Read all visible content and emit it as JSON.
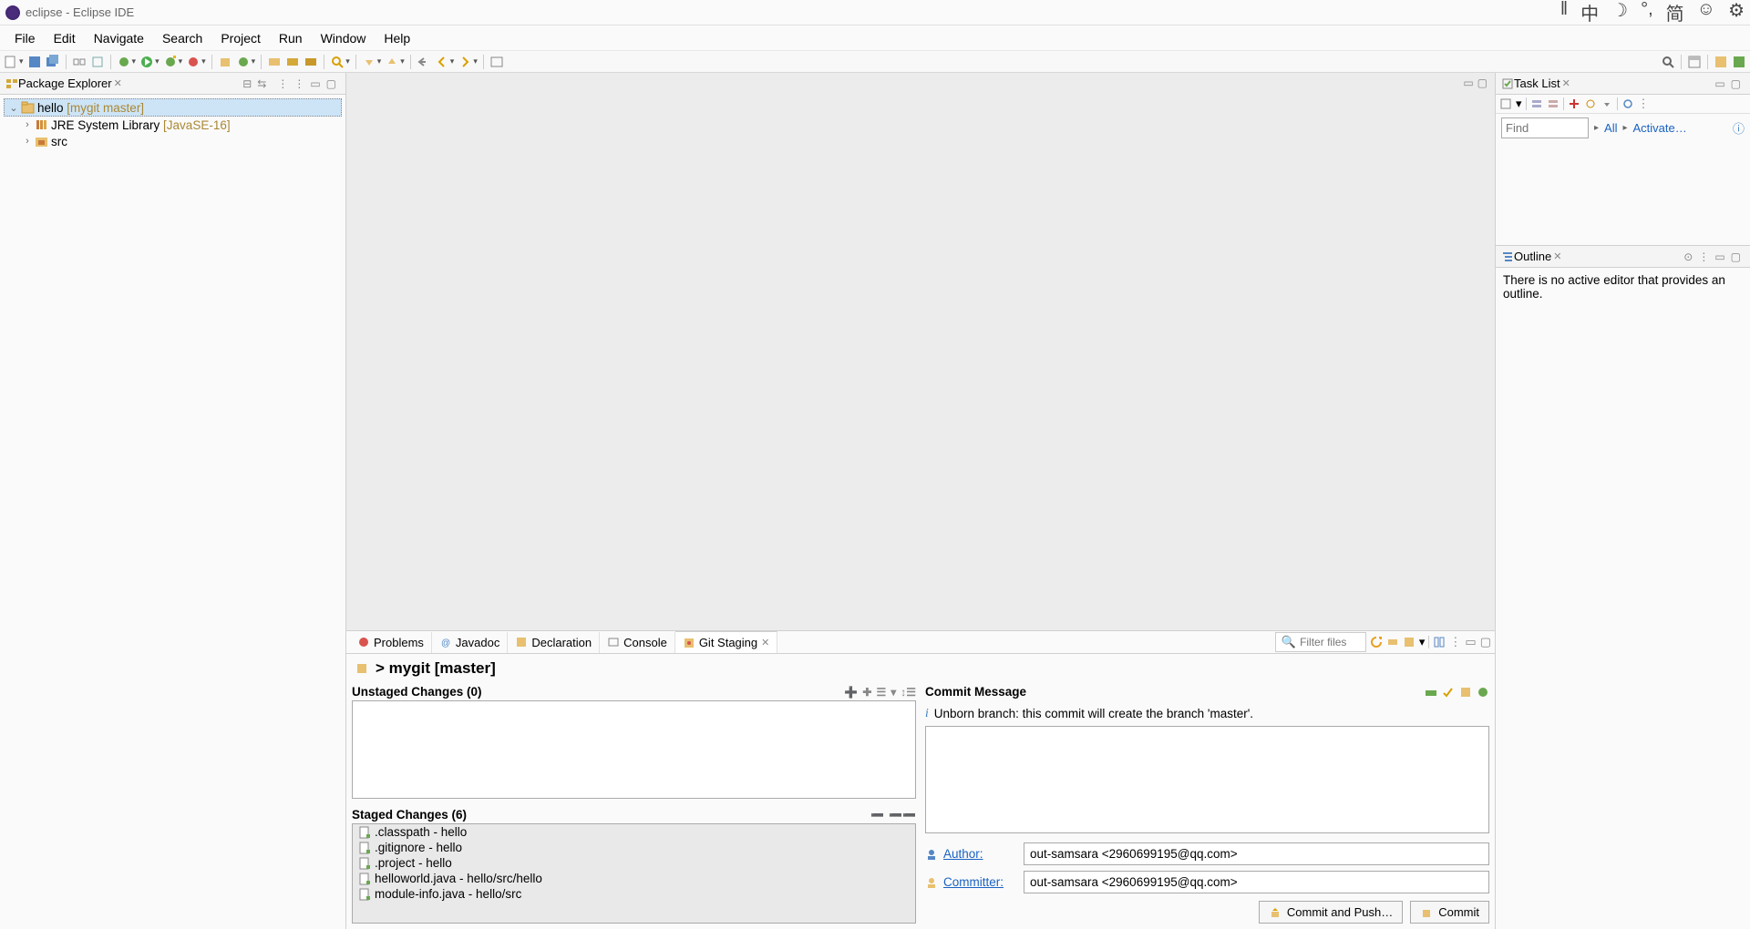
{
  "titlebar": {
    "app": "eclipse",
    "sub": "Eclipse IDE"
  },
  "menubar": [
    "File",
    "Edit",
    "Navigate",
    "Search",
    "Project",
    "Run",
    "Window",
    "Help"
  ],
  "package_explorer": {
    "title": "Package Explorer",
    "project": "hello",
    "project_repo": "[mygit master]",
    "jre": "JRE System Library",
    "jre_ver": "[JavaSE-16]",
    "src": "src"
  },
  "task_list": {
    "title": "Task List",
    "find_placeholder": "Find",
    "all": "All",
    "activate": "Activate…"
  },
  "outline": {
    "title": "Outline",
    "body": "There is no active editor that provides an outline."
  },
  "bottom_tabs": {
    "problems": "Problems",
    "javadoc": "Javadoc",
    "declaration": "Declaration",
    "console": "Console",
    "git_staging": "Git Staging",
    "filter_placeholder": "Filter files"
  },
  "git": {
    "header": "> mygit [master]",
    "unstaged_title": "Unstaged Changes (0)",
    "staged_title": "Staged Changes (6)",
    "staged_items": [
      ".classpath - hello",
      ".gitignore - hello",
      ".project - hello",
      "helloworld.java - hello/src/hello",
      "module-info.java - hello/src"
    ],
    "commit_message_title": "Commit Message",
    "unborn_info": "Unborn branch: this commit will create the branch 'master'.",
    "author_label": "Author:",
    "committer_label": "Committer:",
    "author_value": "out-samsara <2960699195@qq.com>",
    "committer_value": "out-samsara <2960699195@qq.com>",
    "commit_and_push": "Commit and Push…",
    "commit": "Commit"
  }
}
